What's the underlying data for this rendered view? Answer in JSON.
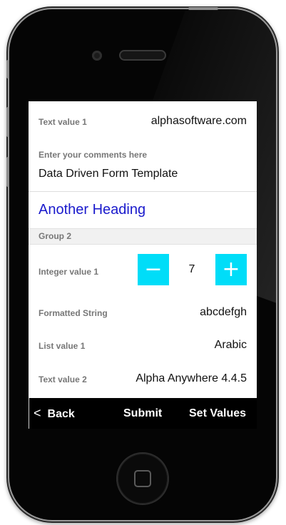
{
  "form": {
    "text_value_1": {
      "label": "Text value 1",
      "value": "alphasoftware.com"
    },
    "comments": {
      "label": "Enter your comments here",
      "value": "Data Driven Form Template"
    },
    "heading": "Another Heading",
    "group_label": "Group 2",
    "integer_value_1": {
      "label": "Integer value 1",
      "value": "7",
      "minus": "−",
      "plus": "+"
    },
    "formatted_string": {
      "label": "Formatted String",
      "value": "abcdefgh"
    },
    "list_value_1": {
      "label": "List value 1",
      "value": "Arabic"
    },
    "text_value_2": {
      "label": "Text value 2",
      "value": "Alpha Anywhere 4.4.5"
    }
  },
  "toolbar": {
    "back_icon": "<",
    "back_label": "Back",
    "submit_label": "Submit",
    "set_values_label": "Set Values"
  },
  "colors": {
    "accent": "#00ddf8",
    "heading": "#1a1acc",
    "label": "#777777",
    "toolbar_bg": "#000000"
  },
  "icons": {
    "back": "chevron-left-icon",
    "decrement": "minus-icon",
    "increment": "plus-icon"
  }
}
